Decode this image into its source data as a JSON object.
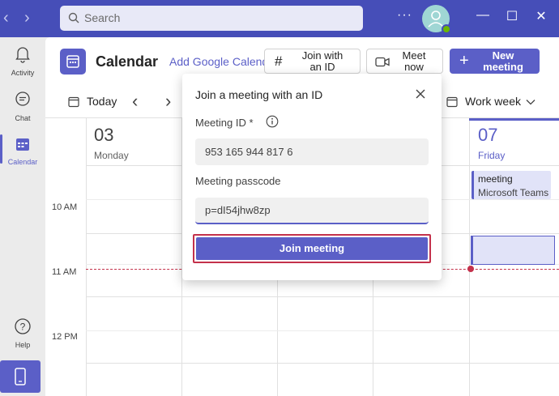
{
  "titlebar": {
    "search_placeholder": "Search",
    "more_glyph": "···"
  },
  "rail": {
    "items": [
      {
        "label": "Activity",
        "icon": "bell-icon"
      },
      {
        "label": "Chat",
        "icon": "chat-icon"
      },
      {
        "label": "Calendar",
        "icon": "calendar-icon"
      },
      {
        "label": "Help",
        "icon": "help-icon"
      }
    ]
  },
  "calendar": {
    "title": "Calendar",
    "add_google": "Add Google Calendar",
    "join_with_id_line1": "Join with",
    "join_with_id_line2": "an ID",
    "meet_now_line1": "Meet",
    "meet_now_line2": "now",
    "new_meeting_line1": "New",
    "new_meeting_line2": "meeting",
    "today": "Today",
    "view": "Work week",
    "days": [
      {
        "num": "03",
        "name": "Monday"
      },
      {
        "num": "07",
        "name": "Friday"
      }
    ],
    "times": [
      "10 AM",
      "11 AM",
      "12 PM"
    ],
    "event": {
      "title": "meeting",
      "subtitle": "Microsoft Teams"
    }
  },
  "dialog": {
    "title": "Join a meeting with an ID",
    "meeting_id_label": "Meeting ID *",
    "meeting_id_value": "953 165 944 817 6",
    "passcode_label": "Meeting passcode",
    "passcode_value": "p=dI54jhw8zp",
    "join_button": "Join meeting"
  },
  "colors": {
    "brand": "#5b5fc7",
    "titlebar": "#464eb8",
    "highlight": "#c4314b"
  }
}
